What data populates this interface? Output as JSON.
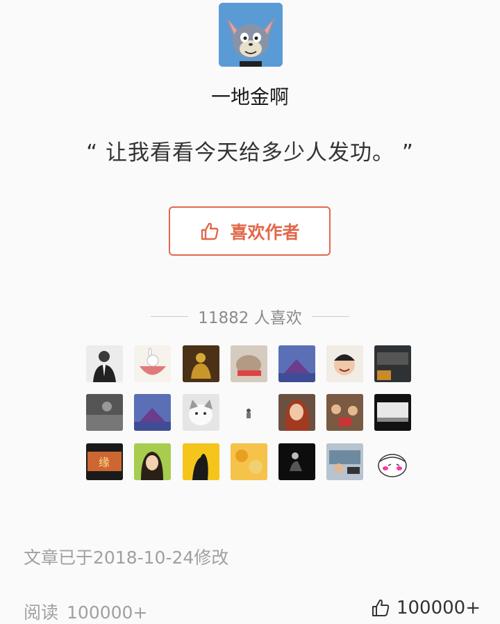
{
  "author": {
    "name": "一地金啊",
    "avatar_icon": "cartoon-cat-avatar-icon"
  },
  "quote": "“ 让我看看今天给多少人发功。 ”",
  "like_button": {
    "label": "喜欢作者",
    "icon": "thumbs-up-icon",
    "color": "#e2674a"
  },
  "likes_summary": {
    "text": "11882 人喜欢"
  },
  "liker_avatars": [
    {
      "icon": "person-suit-avatar"
    },
    {
      "icon": "rabbit-bowl-avatar"
    },
    {
      "icon": "golden-buddha-avatar"
    },
    {
      "icon": "cat-photo-avatar"
    },
    {
      "icon": "cartoon-cat-purple-avatar"
    },
    {
      "icon": "smiling-boy-avatar"
    },
    {
      "icon": "car-photo-avatar"
    },
    {
      "icon": "grayscale-person-avatar"
    },
    {
      "icon": "cartoon-cat-purple-avatar"
    },
    {
      "icon": "white-kitten-avatar"
    },
    {
      "icon": "tiny-figure-avatar"
    },
    {
      "icon": "woman-red-hair-avatar"
    },
    {
      "icon": "group-photo-avatar"
    },
    {
      "icon": "landscape-bw-avatar"
    },
    {
      "icon": "chinese-calligraphy-avatar"
    },
    {
      "icon": "girl-green-background-avatar"
    },
    {
      "icon": "silhouette-yellow-avatar"
    },
    {
      "icon": "autumn-leaves-avatar"
    },
    {
      "icon": "dark-figure-avatar"
    },
    {
      "icon": "car-interior-avatar"
    },
    {
      "icon": "funny-smile-cartoon-avatar"
    }
  ],
  "footer": {
    "modified": "文章已于2018-10-24修改",
    "reads_label": "阅读",
    "reads_count": "100000+",
    "likes_count": "100000+",
    "likes_icon": "thumbs-up-outline-icon"
  }
}
